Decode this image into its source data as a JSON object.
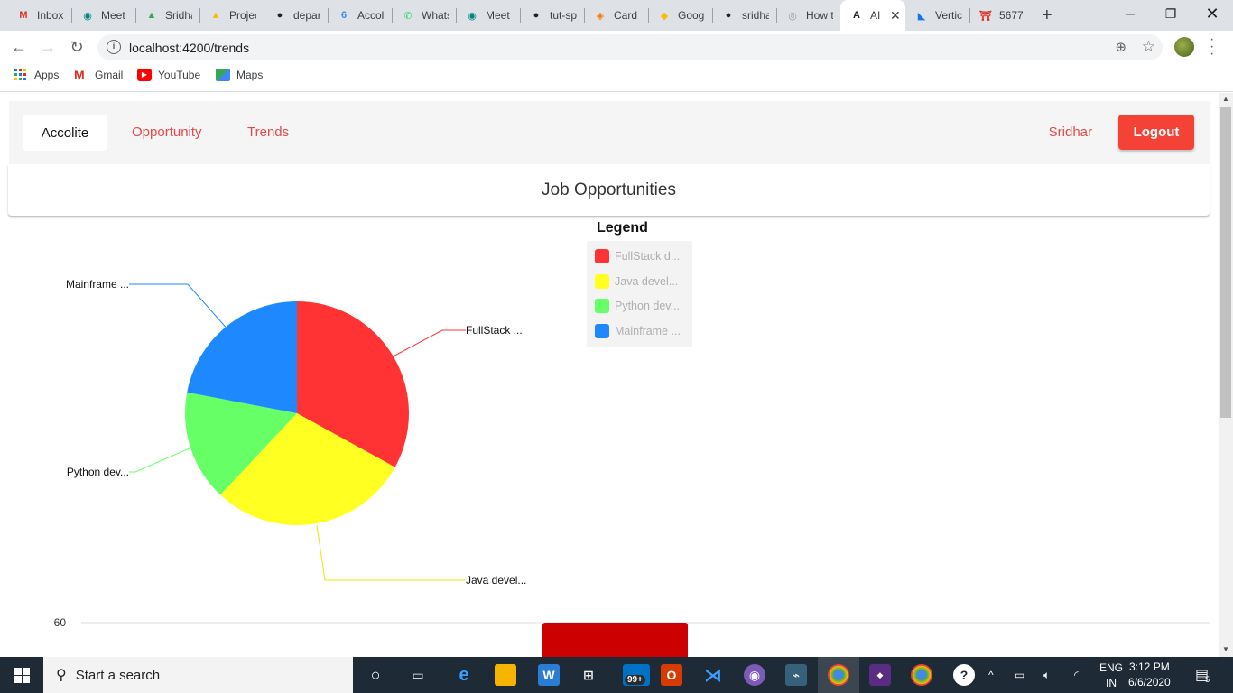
{
  "browser": {
    "tabs": [
      {
        "title": "Inbox",
        "icon": "gmail-icon",
        "color": "#d93025",
        "glyph": "M"
      },
      {
        "title": "Meet",
        "icon": "meet-icon",
        "color": "#00897b",
        "glyph": "◉"
      },
      {
        "title": "Sridhar",
        "icon": "drive-icon",
        "color": "#34a853",
        "glyph": "▲"
      },
      {
        "title": "Project",
        "icon": "drive-icon",
        "color": "#fbbc04",
        "glyph": "▲"
      },
      {
        "title": "depar",
        "icon": "github-icon",
        "color": "#202124",
        "glyph": "●"
      },
      {
        "title": "Accol",
        "icon": "calendar-icon",
        "color": "#4285f4",
        "glyph": "6"
      },
      {
        "title": "Whats",
        "icon": "whatsapp-icon",
        "color": "#25d366",
        "glyph": "✆"
      },
      {
        "title": "Meet",
        "icon": "meet-icon",
        "color": "#00897b",
        "glyph": "◉"
      },
      {
        "title": "tut-sp",
        "icon": "github-icon",
        "color": "#202124",
        "glyph": "●"
      },
      {
        "title": "Card",
        "icon": "shield-icon",
        "color": "#f57c00",
        "glyph": "◈"
      },
      {
        "title": "Goog",
        "icon": "keep-icon",
        "color": "#fbbc04",
        "glyph": "◆"
      },
      {
        "title": "sridha",
        "icon": "github-icon",
        "color": "#202124",
        "glyph": "●"
      },
      {
        "title": "How t",
        "icon": "page-icon",
        "color": "#9aa0a6",
        "glyph": "◎"
      },
      {
        "title": "AI",
        "icon": "angular-icon",
        "color": "#202124",
        "glyph": "A",
        "active": true
      },
      {
        "title": "Vertic",
        "icon": "app-icon",
        "color": "#1a73e8",
        "glyph": "◣"
      },
      {
        "title": "5677",
        "icon": "torii-icon",
        "color": "#d93025",
        "glyph": "⛩"
      }
    ],
    "url": "localhost:4200/trends",
    "bookmarks": [
      "Apps",
      "Gmail",
      "YouTube",
      "Maps"
    ]
  },
  "app": {
    "brand": "Accolite",
    "nav": [
      "Opportunity",
      "Trends"
    ],
    "user": "Sridhar",
    "logout": "Logout",
    "card_title": "Job Opportunities",
    "legend_title": "Legend"
  },
  "chart_data": [
    {
      "type": "pie",
      "title": "",
      "labels": [
        "FullStack d...",
        "Java devel...",
        "Python dev...",
        "Mainframe ..."
      ],
      "callout_labels": [
        "FullStack ...",
        "Java devel...",
        "Python dev...",
        "Mainframe ..."
      ],
      "values": [
        33,
        29,
        16,
        22
      ],
      "colors": [
        "#ff3333",
        "#ffff22",
        "#66ff66",
        "#1e88ff"
      ],
      "legend": "right"
    },
    {
      "type": "bar",
      "title": "",
      "ytick_visible": [
        "60"
      ],
      "bar_color": "#cc0000"
    }
  ],
  "taskbar": {
    "search_placeholder": "Start a search",
    "lang": [
      "ENG",
      "IN"
    ],
    "time": "3:12 PM",
    "date": "6/6/2020",
    "notifications": "5",
    "mail_badge": "99+"
  }
}
